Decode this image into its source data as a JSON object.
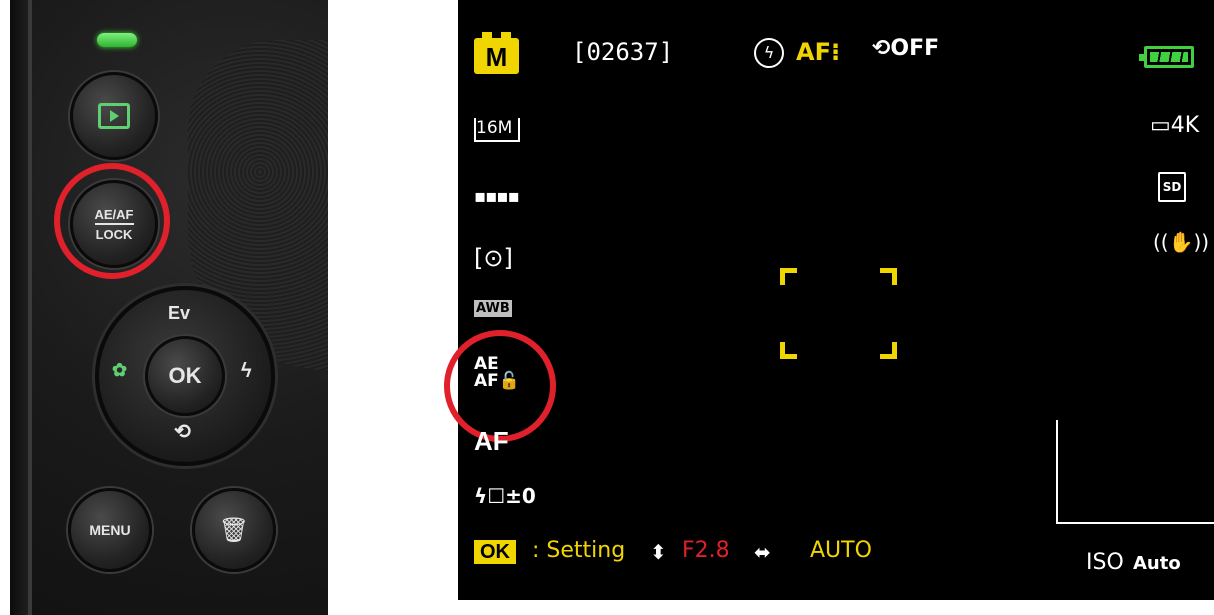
{
  "camera": {
    "play_button_label": "",
    "aeaf_button_line1": "AE/AF",
    "aeaf_button_line2": "LOCK",
    "dpad_up": "Ev",
    "dpad_center": "OK",
    "dpad_left": "✿",
    "dpad_right": "ϟ",
    "dpad_down": "⟲",
    "menu_label": "MENU",
    "trash_symbol": "🗑"
  },
  "lcd": {
    "mode": "M",
    "shot_count": "[02637]",
    "flash_off_symbol": "ϟ",
    "af_indicator": "AF⁝",
    "self_timer": "⟲OFF",
    "resolution": "16M",
    "quality_symbol": "▪▪▪▪",
    "metering_symbol": "[⊙]",
    "white_balance": "AWB",
    "aeaf_lock_line1": "AE",
    "aeaf_lock_line2": "AF🔓",
    "af_mode": "AF",
    "flash_comp": "ϟ☐±0",
    "video_res": "▭4K",
    "storage": "SD",
    "stabilizer_symbol": "((✋))",
    "ok_badge": "OK",
    "setting_text": ": Setting",
    "updown_arrow": "⬍",
    "aperture": "F2.8",
    "leftright_arrow": "⬌",
    "shutter": "AUTO",
    "iso_label": "ISO",
    "iso_value": "Auto"
  },
  "colors": {
    "accent_yellow": "#f1d500",
    "highlight_red": "#e0212b",
    "battery_green": "#3fd13f"
  }
}
